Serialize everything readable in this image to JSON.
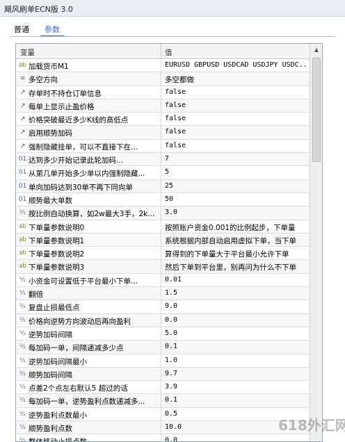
{
  "window": {
    "title": "飓风刷单ECN版 3.0"
  },
  "tabs": [
    {
      "label": "普通"
    },
    {
      "label": "参数"
    }
  ],
  "grid": {
    "columns": {
      "name": "变量",
      "value": "值"
    },
    "rows": [
      {
        "type": "ab",
        "name": "加载货币M1",
        "value": "EURUSD GBPUSD USDCAD USDJPY USDC..."
      },
      {
        "type": "list",
        "name": "多空方向",
        "value": "多空都做"
      },
      {
        "type": "flag",
        "name": "存单时不持仓订单信息",
        "value": "false"
      },
      {
        "type": "flag",
        "name": "每单上显示止盈价格",
        "value": "false"
      },
      {
        "type": "flag",
        "name": "价格突破最近多少K线的高低点",
        "value": "false"
      },
      {
        "type": "flag",
        "name": "启用顺势加码",
        "value": "false"
      },
      {
        "type": "flag",
        "name": "强制隐藏挂单，可以不直接下在...",
        "value": "false"
      },
      {
        "type": "int",
        "name": "达到多少开始记录此轮加码...",
        "value": "7"
      },
      {
        "type": "int",
        "name": "从第几单开始多少单以内强制隐藏...",
        "value": "5"
      },
      {
        "type": "int",
        "name": "单向加码达到30单不再下同向单",
        "value": "25"
      },
      {
        "type": "int",
        "name": "顺势最大单数",
        "value": "50"
      },
      {
        "type": "dbl",
        "name": "按比例自动换算，如2w最大3手，2k...",
        "value": "3.0"
      },
      {
        "type": "ab",
        "name": "下单量参数说明0",
        "value": "按照账户资金0.001的比例起步，下单量"
      },
      {
        "type": "ab",
        "name": "下单量参数说明1",
        "value": "系统根据内部自动启用虚拟下单，当下单"
      },
      {
        "type": "ab",
        "name": "下单量参数说明2",
        "value": "算得到的下单量大于平台最小允许下单"
      },
      {
        "type": "ab",
        "name": "下单量参数说明3",
        "value": "然后下单到平台里，别再问为什么不下单"
      },
      {
        "type": "dbl",
        "name": "小资金可设置低于平台最小下单...",
        "value": "0.01"
      },
      {
        "type": "dbl",
        "name": "翻倍",
        "value": "1.5"
      },
      {
        "type": "dbl",
        "name": "复盘止损最低点",
        "value": "9.0"
      },
      {
        "type": "dbl",
        "name": "价格向逆势方向波动后再向盈利",
        "value": "0.0"
      },
      {
        "type": "dbl",
        "name": "逆势加码间隔",
        "value": "5.0"
      },
      {
        "type": "dbl",
        "name": "每加码一单，间隔递减多少点",
        "value": "0.1"
      },
      {
        "type": "dbl",
        "name": "逆势加码间隔最小",
        "value": "1.0"
      },
      {
        "type": "dbl",
        "name": "顺势加码间隔",
        "value": "9.7"
      },
      {
        "type": "dbl",
        "name": "点差2个点左右默认5  超过的话",
        "value": "3.9"
      },
      {
        "type": "dbl",
        "name": "每加码一单，逆势盈利点数递减多...",
        "value": "0.1"
      },
      {
        "type": "dbl",
        "name": "逆势盈利点数最小",
        "value": "0.5"
      },
      {
        "type": "dbl",
        "name": "顺势盈利点数",
        "value": "10.0"
      },
      {
        "type": "dbl",
        "name": "整体移动止损点数",
        "value": "0.0"
      }
    ]
  },
  "icons": {
    "ab": "ab",
    "list": "list-icon",
    "flag": "bool-flag-icon",
    "int": "01",
    "dbl": "½"
  },
  "colors": {
    "accent": "#3a72c8",
    "grid_border": "#9aa6b6"
  },
  "watermark": "618外汇网"
}
